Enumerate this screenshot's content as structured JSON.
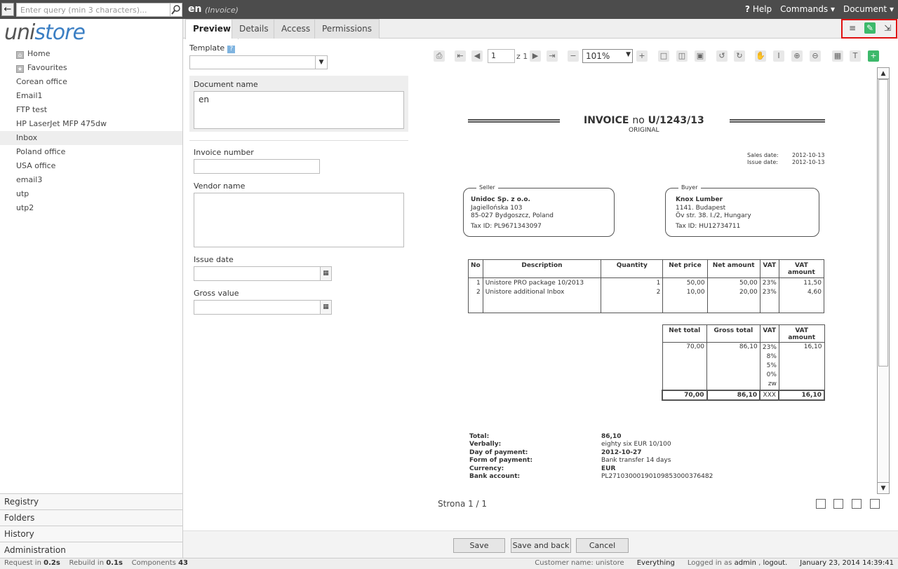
{
  "topbar": {
    "search_placeholder": "Enter query (min 3 characters)...",
    "doc_title": "en",
    "doc_type": "(Invoice)",
    "help": "Help",
    "commands": "Commands",
    "document": "Document"
  },
  "sidebar": {
    "logo_a": "uni",
    "logo_b": "store",
    "items": [
      "Home",
      "Favourites",
      "Corean office",
      "Email1",
      "FTP test",
      "HP LaserJet MFP 475dw",
      "Inbox",
      "Poland office",
      "USA office",
      "email3",
      "utp",
      "utp2"
    ],
    "bottom": [
      "Registry",
      "Folders",
      "History",
      "Administration"
    ]
  },
  "tabs": [
    "Preview",
    "Details",
    "Access",
    "Permissions"
  ],
  "form": {
    "template_label": "Template",
    "docname_label": "Document name",
    "docname_value": "en",
    "invoice_number_label": "Invoice number",
    "vendor_label": "Vendor name",
    "issue_date_label": "Issue date",
    "gross_label": "Gross value"
  },
  "viewer": {
    "page": "1",
    "page_of": "z 1",
    "zoom": "101%",
    "strona": "Strona 1 / 1"
  },
  "invoice": {
    "title_a": "INVOICE",
    "title_b": "no",
    "title_c": "U/1243/13",
    "original": "ORIGINAL",
    "sales_date_label": "Sales date:",
    "sales_date": "2012-10-13",
    "issue_date_label": "Issue date:",
    "issue_date": "2012-10-13",
    "seller_cap": "Seller",
    "seller": [
      "Unidoc Sp. z o.o.",
      "Jagiellońska 103",
      "85-027 Bydgoszcz, Poland",
      "Tax ID: PL9671343097"
    ],
    "buyer_cap": "Buyer",
    "buyer": [
      "Knox Lumber",
      "1141. Budapest",
      "Öv str. 38. I./2, Hungary",
      "Tax ID: HU12734711"
    ],
    "items_header": [
      "No",
      "Description",
      "Quantity",
      "Net price",
      "Net amount",
      "VAT",
      "VAT amount"
    ],
    "items": [
      [
        "1",
        "Unistore PRO package 10/2013",
        "1",
        "50,00",
        "50,00",
        "23%",
        "11,50"
      ],
      [
        "2",
        "Unistore additional Inbox",
        "2",
        "10,00",
        "20,00",
        "23%",
        "4,60"
      ]
    ],
    "sum_header": [
      "Net total",
      "Gross total",
      "VAT",
      "VAT amount"
    ],
    "sum_row": [
      "70,00",
      "86,10",
      "23%",
      "16,10"
    ],
    "vat_rates": [
      "8%",
      "5%",
      "0%",
      "zw"
    ],
    "sum_total": [
      "70,00",
      "86,10",
      "XXX",
      "16,10"
    ],
    "footer_labels": [
      "Total:",
      "Verbally:",
      "Day of payment:",
      "Form of payment:",
      "Currency:",
      "Bank account:"
    ],
    "footer_values": [
      "86,10",
      "eighty six EUR 10/100",
      "2012-10-27",
      "Bank transfer 14 days",
      "EUR",
      "PL27103000190109853000376482"
    ]
  },
  "buttons": {
    "save": "Save",
    "save_back": "Save and back",
    "cancel": "Cancel"
  },
  "status": {
    "request_label": "Request in",
    "request_val": "0.2s",
    "rebuild_label": "Rebuild in",
    "rebuild_val": "0.1s",
    "components_label": "Components",
    "components_val": "43",
    "customer": "Customer name: unistore",
    "everything": "Everything",
    "logged_label": "Logged in as",
    "user": "admin",
    "logout": "logout.",
    "datetime": "January 23, 2014 14:39:41"
  },
  "colors": {
    "topbar": "#4c4c4c",
    "accent_blue": "#3b7fc4",
    "green": "#3db96b",
    "highlight": "#e01010"
  },
  "icons": [
    "back-arrow-icon",
    "search-icon",
    "help-icon",
    "list-icon",
    "edit-icon",
    "fullscreen-icon",
    "print-icon",
    "calendar-icon",
    "add-icon"
  ]
}
